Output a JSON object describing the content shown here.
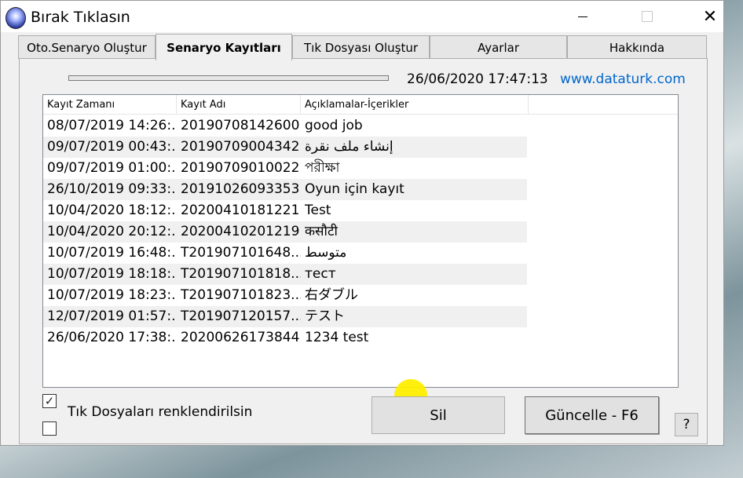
{
  "window": {
    "title": "Bırak Tıklasın",
    "min_label": "—",
    "max_label": "☐",
    "close_label": "✕"
  },
  "tabs": [
    {
      "label": "Oto.Senaryo Oluştur"
    },
    {
      "label": "Senaryo Kayıtları"
    },
    {
      "label": "Tık Dosyası Oluştur"
    },
    {
      "label": "Ayarlar"
    },
    {
      "label": "Hakkında"
    }
  ],
  "active_tab": 1,
  "header": {
    "datetime": "26/06/2020 17:47:13",
    "website": "www.dataturk.com",
    "progress_fraction": 0
  },
  "list": {
    "columns": [
      "Kayıt Zamanı",
      "Kayıt Adı",
      "Açıklamalar-İçerikler"
    ],
    "rows": [
      [
        "08/07/2019 14:26:...",
        "20190708142600",
        "good job"
      ],
      [
        "09/07/2019 00:43:...",
        "20190709004342",
        "إنشاء ملف نقرة"
      ],
      [
        "09/07/2019 01:00:...",
        "20190709010022",
        "পরীক্ষা"
      ],
      [
        "26/10/2019 09:33:...",
        "20191026093353",
        "Oyun için kayıt"
      ],
      [
        "10/04/2020 18:12:...",
        "20200410181221",
        "Test"
      ],
      [
        "10/04/2020 20:12:...",
        "20200410201219",
        " कसौटी"
      ],
      [
        "10/07/2019 16:48:...",
        "T201907101648...",
        "متوسط"
      ],
      [
        "10/07/2019 18:18:...",
        "T201907101818...",
        "тест"
      ],
      [
        "10/07/2019 18:23:...",
        "T201907101823...",
        "右ダブル"
      ],
      [
        "12/07/2019 01:57:...",
        "T201907120157...",
        "テスト"
      ],
      [
        "26/06/2020 17:38:...",
        "20200626173844",
        "1234 test"
      ]
    ]
  },
  "options": {
    "checkbox1_checked": true,
    "checkbox1_mark": "✓",
    "checkbox2_checked": false,
    "label": "Tık Dosyaları renklendirilsin"
  },
  "buttons": {
    "delete_label": "Sil",
    "update_label": "Güncelle - F6",
    "help_label": "?"
  }
}
